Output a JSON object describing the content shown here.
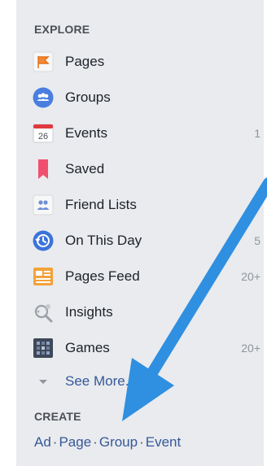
{
  "explore": {
    "title": "EXPLORE",
    "items": [
      {
        "label": "Pages",
        "count": "",
        "icon": "flag-icon"
      },
      {
        "label": "Groups",
        "count": "",
        "icon": "groups-icon"
      },
      {
        "label": "Events",
        "count": "1",
        "icon": "calendar-icon",
        "icon_text": "26"
      },
      {
        "label": "Saved",
        "count": "",
        "icon": "bookmark-icon"
      },
      {
        "label": "Friend Lists",
        "count": "",
        "icon": "friend-lists-icon"
      },
      {
        "label": "On This Day",
        "count": "5",
        "icon": "on-this-day-icon"
      },
      {
        "label": "Pages Feed",
        "count": "20+",
        "icon": "pages-feed-icon"
      },
      {
        "label": "Insights",
        "count": "",
        "icon": "insights-icon"
      },
      {
        "label": "Games",
        "count": "20+",
        "icon": "games-icon"
      }
    ],
    "see_more": "See More..."
  },
  "create": {
    "title": "CREATE",
    "links": [
      "Ad",
      "Page",
      "Group",
      "Event"
    ],
    "separator": "·"
  },
  "colors": {
    "panel_bg": "#e9ebee",
    "link": "#365899",
    "arrow": "#2f8fe0"
  }
}
